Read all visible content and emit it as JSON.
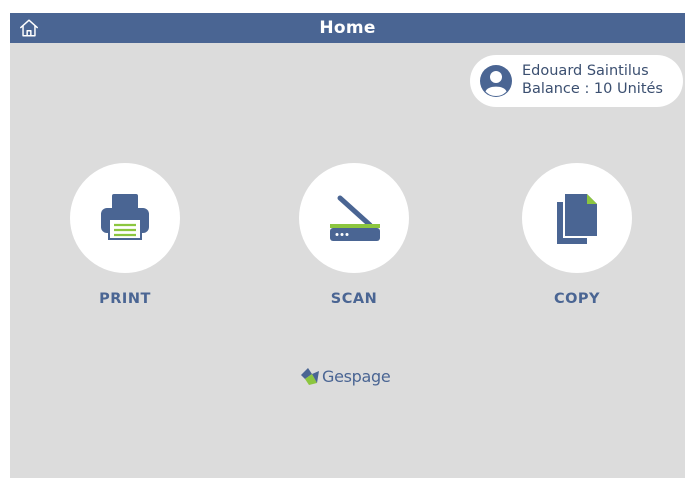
{
  "header": {
    "title": "Home",
    "home_icon": "home-icon"
  },
  "user": {
    "name": "Edouard Saintilus",
    "balance": "Balance : 10 Unités",
    "avatar_icon": "user-avatar-icon"
  },
  "actions": [
    {
      "label": "PRINT",
      "icon": "printer-icon"
    },
    {
      "label": "SCAN",
      "icon": "scanner-icon"
    },
    {
      "label": "COPY",
      "icon": "copy-icon"
    }
  ],
  "brand": {
    "name": "Gespage"
  },
  "colors": {
    "primary": "#4a6593",
    "background": "#dcdcdc",
    "accent_green": "#8cc63f",
    "card": "#ffffff"
  }
}
